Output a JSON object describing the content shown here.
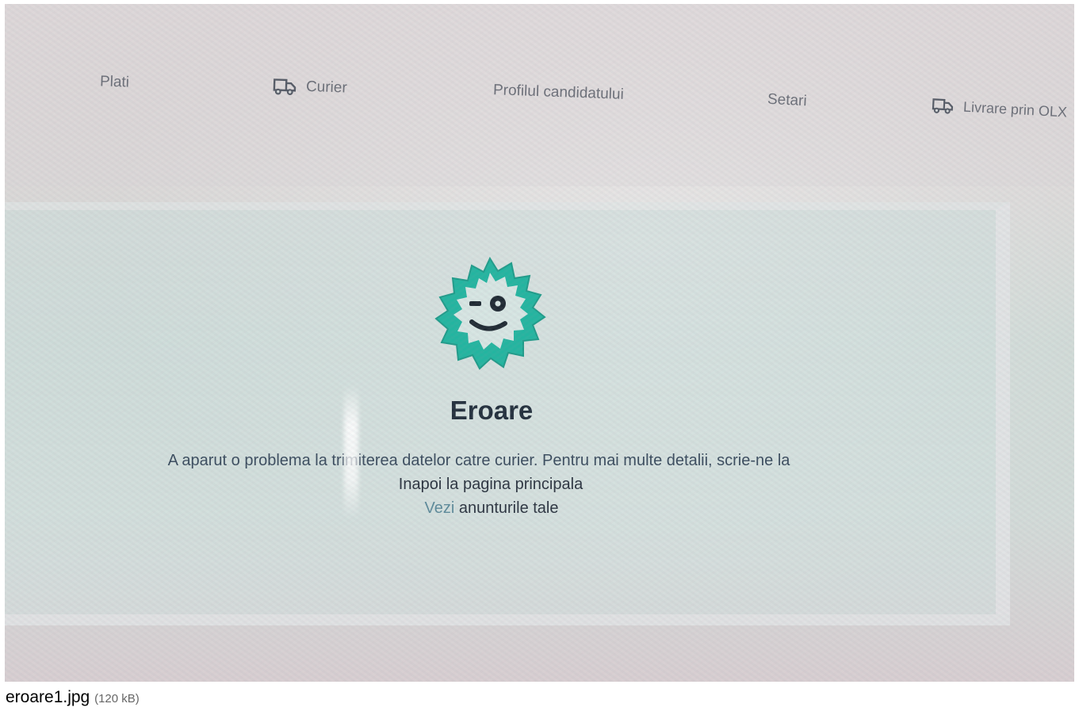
{
  "nav": {
    "items": [
      {
        "label": "Plati"
      },
      {
        "label": "Curier",
        "icon": "truck-icon"
      },
      {
        "label": "Profilul candidatului"
      },
      {
        "label": "Setari"
      },
      {
        "label": "Livrare prin OLX",
        "icon": "truck-icon"
      }
    ]
  },
  "error": {
    "icon": "winking-badge-icon",
    "title": "Eroare",
    "message": "A aparut o problema la trimiterea datelor catre curier. Pentru mai multe detalii, scrie-ne la",
    "home_link": "Inapoi la pagina principala",
    "ads_prefix": "Vezi",
    "ads_link": " anunturile tale"
  },
  "colors": {
    "accent": "#23b5a0",
    "title": "#23303d"
  },
  "caption": {
    "filename": "eroare1.jpg",
    "size": "(120 kB)"
  }
}
